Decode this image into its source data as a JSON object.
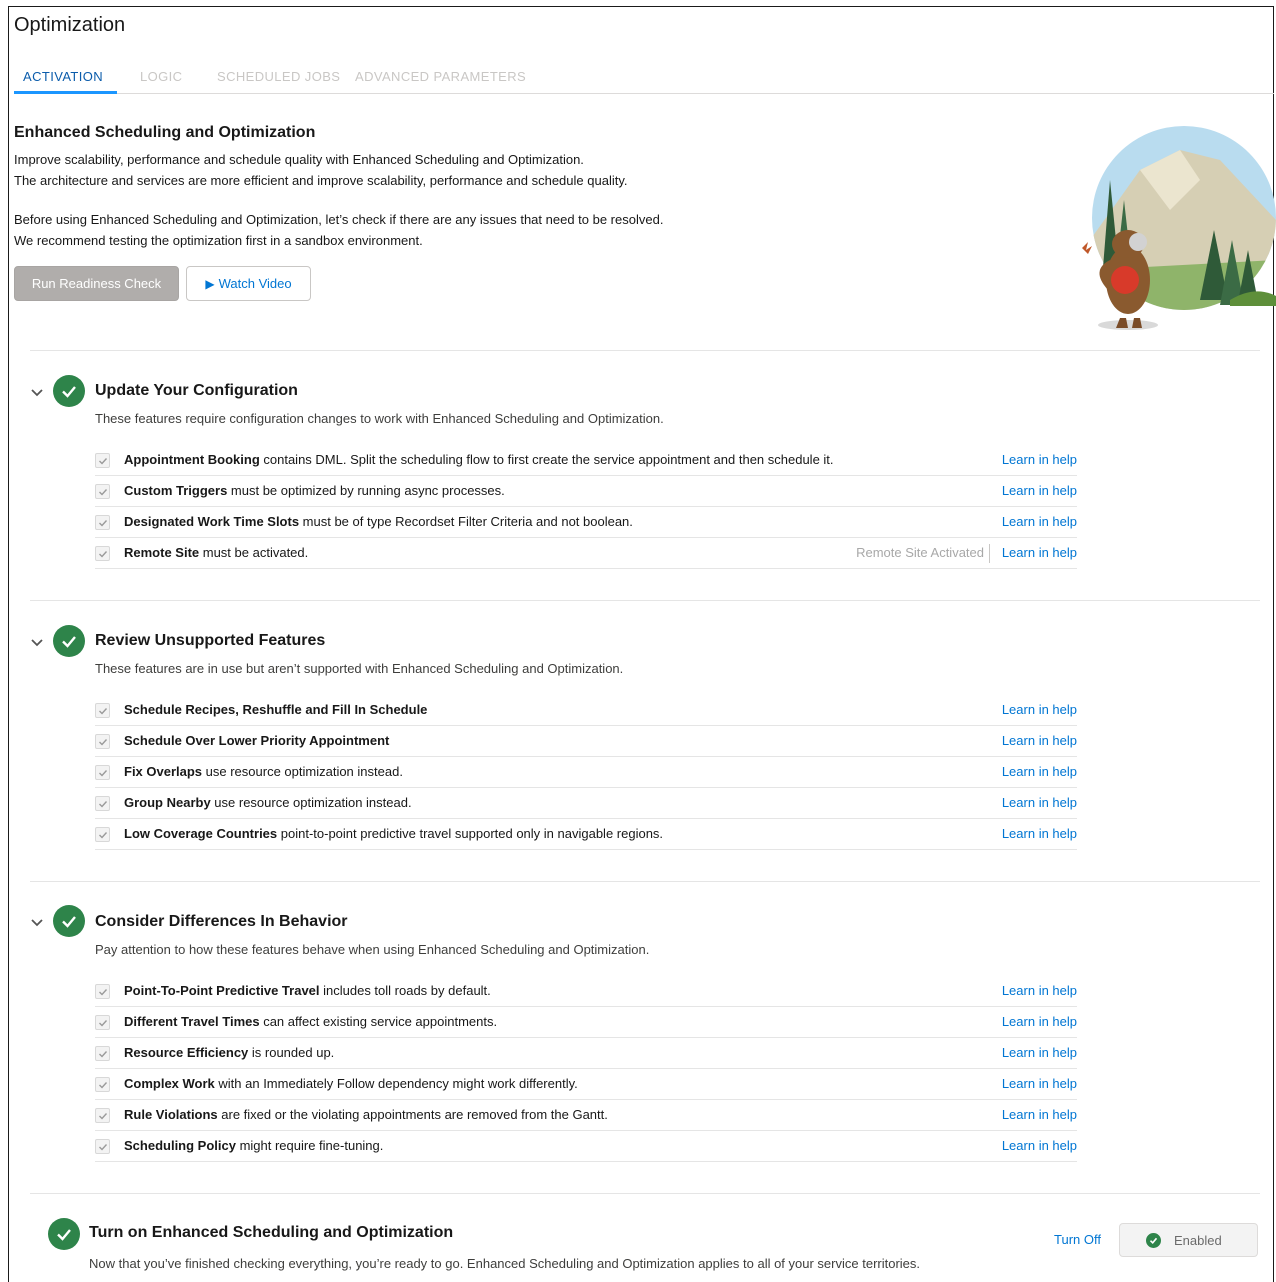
{
  "page": {
    "title": "Optimization"
  },
  "tabs": [
    {
      "label": "ACTIVATION",
      "active": true
    },
    {
      "label": "LOGIC",
      "active": false
    },
    {
      "label": "SCHEDULED JOBS",
      "active": false
    },
    {
      "label": "ADVANCED PARAMETERS",
      "active": false
    }
  ],
  "intro": {
    "title": "Enhanced Scheduling and Optimization",
    "lines": [
      "Improve scalability, performance and schedule quality with Enhanced Scheduling and Optimization.",
      "The architecture and services are more efficient and improve scalability, performance and schedule quality.",
      "Before using Enhanced Scheduling and Optimization, let’s check if there are any issues that need to be resolved.",
      "We recommend testing the optimization first in a sandbox environment."
    ],
    "readiness_button": "Run Readiness Check",
    "video_button": "Watch Video"
  },
  "sections": [
    {
      "title": "Update Your Configuration",
      "subtitle": "These features require configuration changes to work with Enhanced Scheduling and Optimization.",
      "items": [
        {
          "bold": "Appointment Booking",
          "rest": " contains DML. Split the scheduling flow to first create the service appointment and then schedule it.",
          "link": "Learn in help"
        },
        {
          "bold": "Custom Triggers",
          "rest": " must be optimized by running async processes.",
          "link": "Learn in help"
        },
        {
          "bold": "Designated Work Time Slots",
          "rest": " must be of type Recordset Filter Criteria and not boolean.",
          "link": "Learn in help"
        },
        {
          "bold": "Remote Site",
          "rest": " must be activated.",
          "status": "Remote Site Activated",
          "link": "Learn in help"
        }
      ]
    },
    {
      "title": "Review Unsupported Features",
      "subtitle": "These features are in use but aren’t supported with Enhanced Scheduling and Optimization.",
      "items": [
        {
          "bold": "Schedule Recipes, Reshuffle and Fill In Schedule",
          "rest": "",
          "link": "Learn in help"
        },
        {
          "bold": "Schedule Over Lower Priority Appointment",
          "rest": "",
          "link": "Learn in help"
        },
        {
          "bold": "Fix Overlaps",
          "rest": " use resource optimization instead.",
          "link": "Learn in help"
        },
        {
          "bold": "Group Nearby",
          "rest": " use resource optimization instead.",
          "link": "Learn in help"
        },
        {
          "bold": "Low Coverage Countries",
          "rest": " point-to-point predictive travel supported only in navigable regions.",
          "link": "Learn in help"
        }
      ]
    },
    {
      "title": "Consider Differences In Behavior",
      "subtitle": "Pay attention to how these features behave when using Enhanced Scheduling and Optimization.",
      "items": [
        {
          "bold": "Point-To-Point Predictive Travel",
          "rest": " includes toll roads by default.",
          "link": "Learn in help"
        },
        {
          "bold": "Different Travel Times",
          "rest": " can affect existing service appointments.",
          "link": "Learn in help"
        },
        {
          "bold": "Resource Efficiency",
          "rest": " is rounded up.",
          "link": "Learn in help"
        },
        {
          "bold": "Complex Work",
          "rest": " with an Immediately Follow dependency might work differently.",
          "link": "Learn in help"
        },
        {
          "bold": "Rule Violations",
          "rest": " are fixed or the violating appointments are removed from the Gantt.",
          "link": "Learn in help"
        },
        {
          "bold": "Scheduling Policy",
          "rest": " might require fine-tuning.",
          "link": "Learn in help"
        }
      ]
    }
  ],
  "final": {
    "title": "Turn on Enhanced Scheduling and Optimization",
    "subtitle": "Now that you’ve finished checking everything, you’re ready to go. Enhanced Scheduling and Optimization applies to all of your service territories.",
    "turn_off": "Turn Off",
    "status": "Enabled"
  },
  "colors": {
    "accent": "#0176d3",
    "success": "#2e844a",
    "tab_active": "#0b5cab"
  }
}
